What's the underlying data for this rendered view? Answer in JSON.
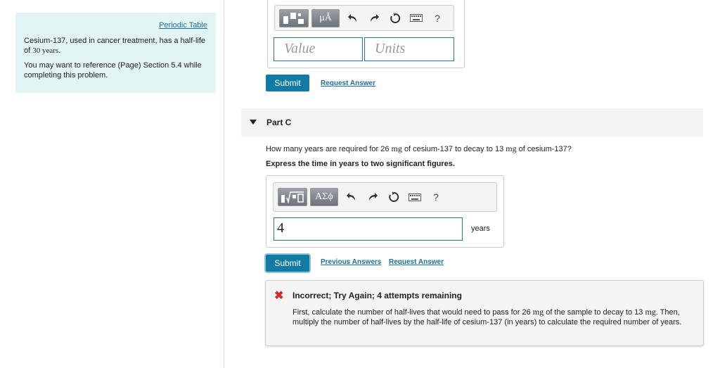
{
  "sidebar": {
    "periodic_table_link": "Periodic Table",
    "intro_text": "Cesium-137, used in cancer treatment, has a half-life of",
    "half_life_value": "30 years",
    "reference_text": "You may want to reference (Page) Section 5.4 while completing this problem."
  },
  "part_b": {
    "toolbar": {
      "symbols_label": "μÅ",
      "help_label": "?"
    },
    "value_placeholder": "Value",
    "units_placeholder": "Units",
    "submit_label": "Submit",
    "request_answer_label": "Request Answer"
  },
  "part_c": {
    "title": "Part C",
    "question_pre": "How many years are required for 26",
    "question_unit1": "mg",
    "question_mid": "of cesium-137 to decay to 13",
    "question_unit2": "mg",
    "question_post": "of cesium-137?",
    "instruction": "Express the time in years to two significant figures.",
    "toolbar": {
      "symbols_label": "ΑΣϕ",
      "help_label": "?"
    },
    "answer_value": "4",
    "units_label": "years",
    "submit_label": "Submit",
    "previous_answers_label": "Previous Answers",
    "request_answer_label": "Request Answer"
  },
  "feedback": {
    "status_color": "#d12c2c",
    "title": "Incorrect; Try Again; 4 attempts remaining",
    "body_1": "First, calculate the number of half-lives that would need to pass for 26",
    "unit1": "mg",
    "body_2": "of the sample to decay to 13",
    "unit2": "mg.",
    "body_3": "Then, multiply the number of half-lives by the half-life of cesium-137 (in years) to calculate the required number of years."
  },
  "colors": {
    "accent": "#137ba3",
    "sidebar_bg": "#e3f4f5",
    "link": "#1b6f9a"
  }
}
